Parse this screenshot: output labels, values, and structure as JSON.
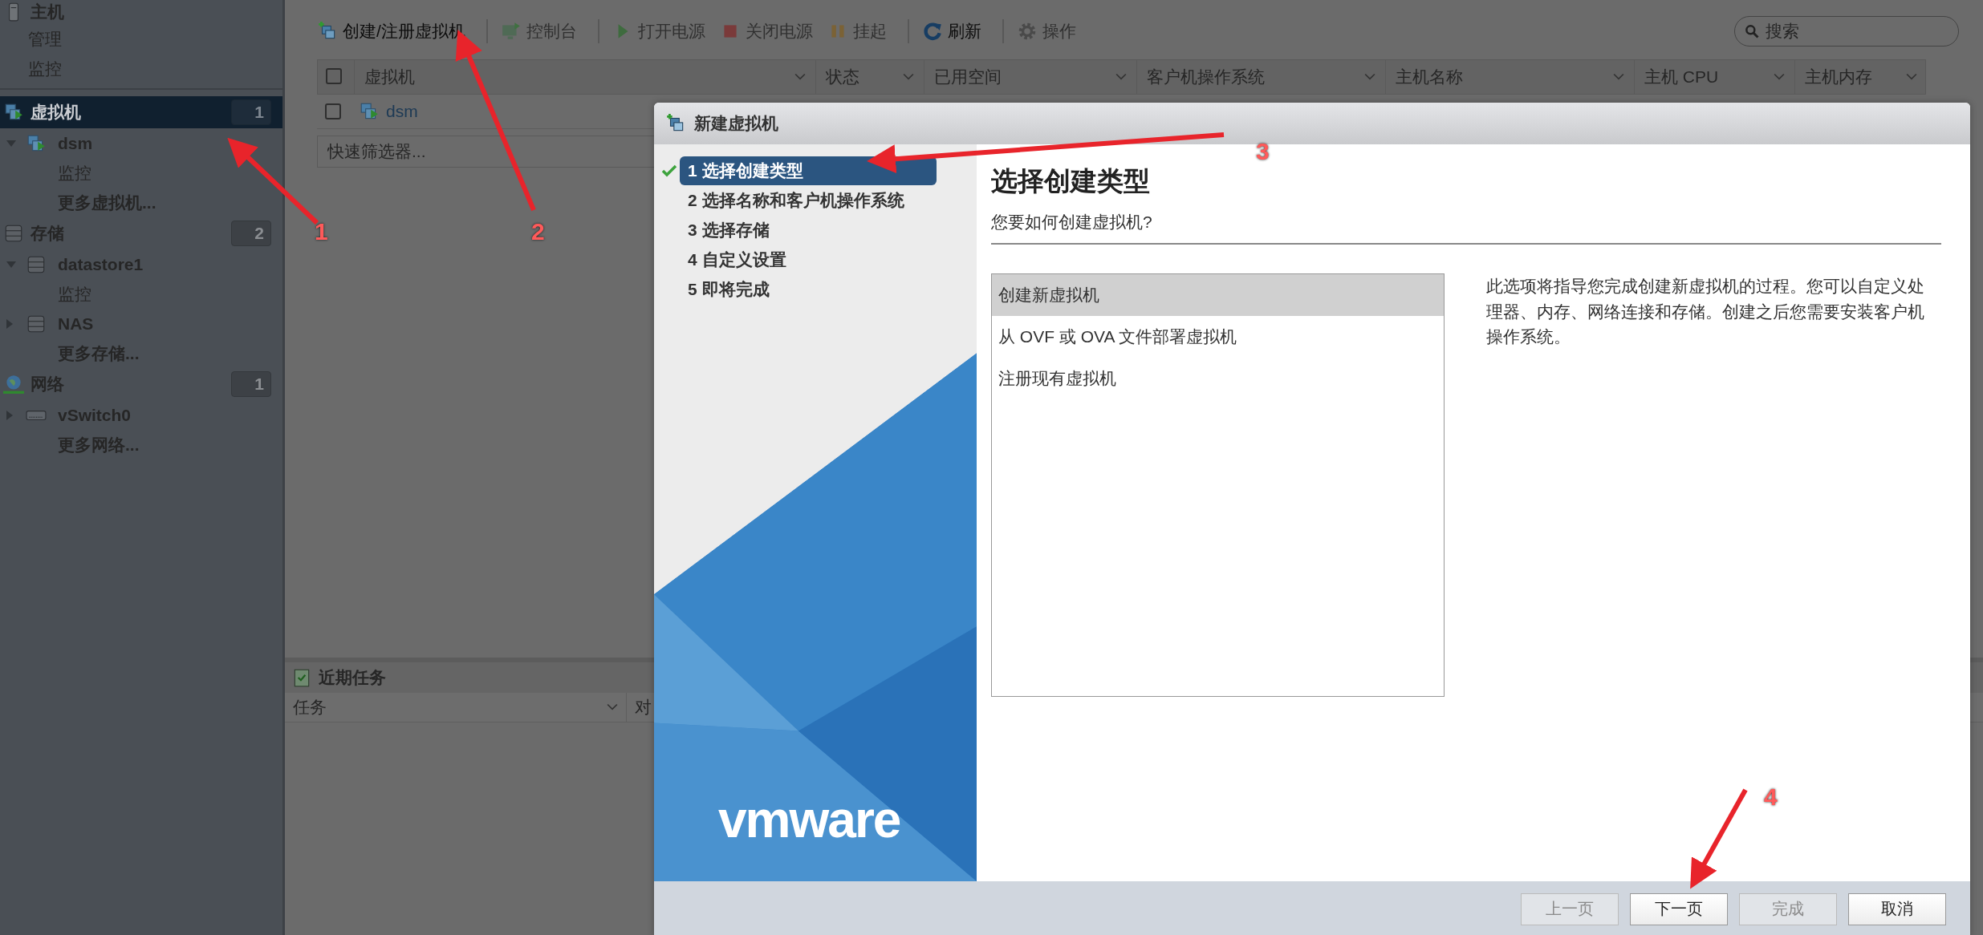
{
  "sidebar": {
    "sections": [
      {
        "label": "主机",
        "kind": "host",
        "selected": false,
        "children": [
          {
            "label": "管理",
            "kind": "page"
          },
          {
            "label": "监控",
            "kind": "page"
          }
        ]
      },
      {
        "label": "虚拟机",
        "kind": "vm",
        "selected": true,
        "count": "1",
        "children": [
          {
            "label": "dsm",
            "kind": "vm",
            "expanded": true,
            "children": [
              {
                "label": "监控",
                "kind": "page"
              }
            ]
          },
          {
            "label": "更多虚拟机...",
            "kind": "more"
          }
        ]
      },
      {
        "label": "存储",
        "kind": "storage",
        "selected": false,
        "count": "2",
        "children": [
          {
            "label": "datastore1",
            "kind": "storage",
            "expanded": true,
            "children": [
              {
                "label": "监控",
                "kind": "page"
              }
            ]
          },
          {
            "label": "NAS",
            "kind": "storage",
            "expanded": false
          },
          {
            "label": "更多存储...",
            "kind": "more"
          }
        ]
      },
      {
        "label": "网络",
        "kind": "network",
        "selected": false,
        "count": "1",
        "children": [
          {
            "label": "vSwitch0",
            "kind": "switch",
            "expanded": false
          },
          {
            "label": "更多网络...",
            "kind": "more"
          }
        ]
      }
    ]
  },
  "toolbar": {
    "groups": [
      [
        {
          "label": "创建/注册虚拟机",
          "kind": "create",
          "disabled": false
        }
      ],
      [
        {
          "label": "控制台",
          "kind": "console",
          "disabled": true
        }
      ],
      [
        {
          "label": "打开电源",
          "kind": "power-on",
          "disabled": true
        },
        {
          "label": "关闭电源",
          "kind": "power-off",
          "disabled": true
        },
        {
          "label": "挂起",
          "kind": "suspend",
          "disabled": true
        }
      ],
      [
        {
          "label": "刷新",
          "kind": "refresh",
          "disabled": false
        }
      ],
      [
        {
          "label": "操作",
          "kind": "actions",
          "disabled": true
        }
      ]
    ],
    "search": {
      "placeholder": "搜索"
    }
  },
  "table": {
    "all_checked": false,
    "columns": [
      "虚拟机",
      "状态",
      "已用空间",
      "客户机操作系统",
      "主机名称",
      "主机 CPU",
      "主机内存"
    ],
    "rows": [
      {
        "name": "dsm",
        "checked": false
      }
    ],
    "filter": {
      "placeholder": "快速筛选器..."
    }
  },
  "recent_tasks": {
    "title": "近期任务",
    "columns": [
      "任务",
      "对"
    ]
  },
  "dialog": {
    "title": "新建虚拟机",
    "steps": [
      {
        "label": "1 选择创建类型",
        "selected": true,
        "checked": true
      },
      {
        "label": "2 选择名称和客户机操作系统",
        "selected": false,
        "checked": false
      },
      {
        "label": "3 选择存储",
        "selected": false,
        "checked": false
      },
      {
        "label": "4 自定义设置",
        "selected": false,
        "checked": false
      },
      {
        "label": "5 即将完成",
        "selected": false,
        "checked": false
      }
    ],
    "logo": "vmware",
    "heading": "选择创建类型",
    "question": "您要如何创建虚拟机?",
    "options": [
      {
        "label": "创建新虚拟机",
        "selected": true
      },
      {
        "label": "从 OVF 或 OVA 文件部署虚拟机",
        "selected": false
      },
      {
        "label": "注册现有虚拟机",
        "selected": false
      }
    ],
    "description": "此选项将指导您完成创建新虚拟机的过程。您可以自定义处理器、内存、网络连接和存储。创建之后您需要安装客户机操作系统。",
    "buttons": [
      {
        "label": "上一页",
        "disabled": true
      },
      {
        "label": "下一页",
        "disabled": false
      },
      {
        "label": "完成",
        "disabled": true
      },
      {
        "label": "取消",
        "disabled": false
      }
    ]
  },
  "annotations": [
    {
      "label": "1"
    },
    {
      "label": "2"
    },
    {
      "label": "3"
    },
    {
      "label": "4"
    }
  ]
}
